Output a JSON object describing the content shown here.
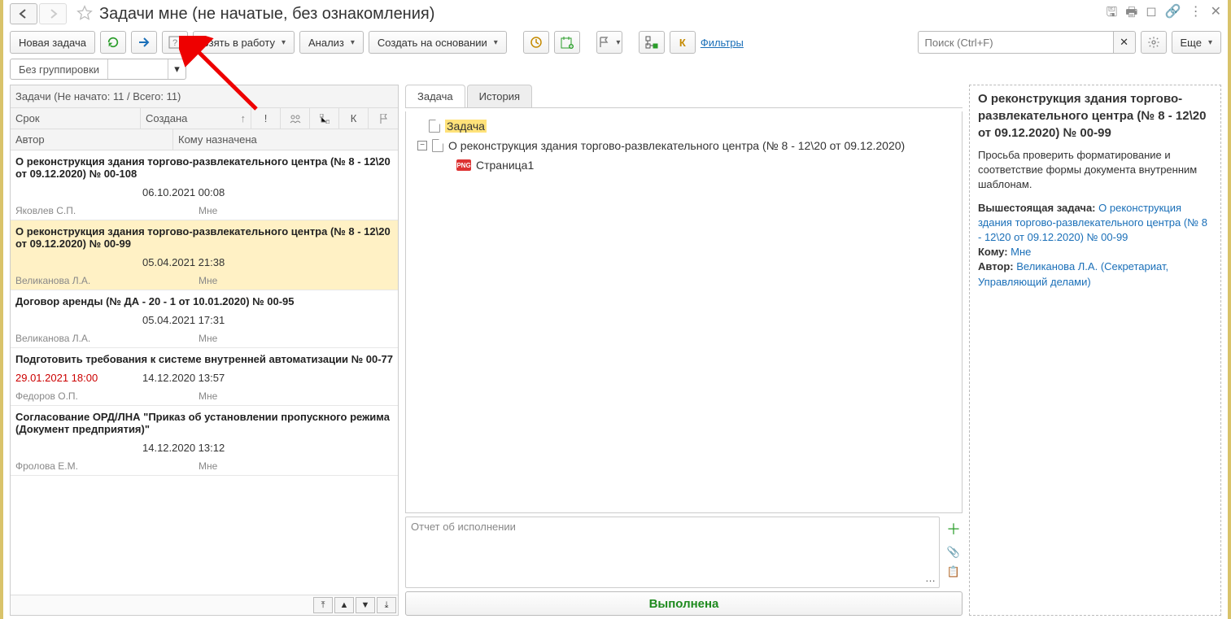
{
  "header": {
    "title": "Задачи мне (не начатые, без ознакомления)"
  },
  "toolbar": {
    "new_task": "Новая задача",
    "take_work": "Взять в работу",
    "analyze": "Анализ",
    "create_based": "Создать на основании",
    "filters": "Фильтры",
    "search_placeholder": "Поиск (Ctrl+F)",
    "more": "Еще"
  },
  "grouping": {
    "value": "Без группировки"
  },
  "list_header": {
    "summary": "Задачи (Не начато: 11 / Всего: 11)",
    "col_due": "Срок",
    "col_created": "Создана",
    "col_author": "Автор",
    "col_assigned": "Кому назначена",
    "k": "К"
  },
  "tasks": [
    {
      "title": "О реконструкция здания торгово-развлекательного центра (№ 8 - 12\\20 от 09.12.2020) № 00-108",
      "due": "",
      "created": "06.10.2021 00:08",
      "author": "Яковлев С.П.",
      "assigned": "Мне",
      "selected": false,
      "due_red": false
    },
    {
      "title": "О реконструкция здания торгово-развлекательного центра (№ 8 - 12\\20 от 09.12.2020) № 00-99",
      "due": "",
      "created": "05.04.2021 21:38",
      "author": "Великанова Л.А.",
      "assigned": "Мне",
      "selected": true,
      "due_red": false
    },
    {
      "title": "Договор аренды (№ ДА - 20 - 1 от 10.01.2020) № 00-95",
      "due": "",
      "created": "05.04.2021 17:31",
      "author": "Великанова Л.А.",
      "assigned": "Мне",
      "selected": false,
      "due_red": false
    },
    {
      "title": "Подготовить требования к системе внутренней автоматизации № 00-77",
      "due": "29.01.2021 18:00",
      "created": "14.12.2020 13:57",
      "author": "Федоров О.П.",
      "assigned": "Мне",
      "selected": false,
      "due_red": true
    },
    {
      "title": "Согласование ОРД/ЛНА \"Приказ об установлении пропускного режима (Документ предприятия)\"",
      "due": "",
      "created": "14.12.2020 13:12",
      "author": "Фролова Е.М.",
      "assigned": "Мне",
      "selected": false,
      "due_red": false
    }
  ],
  "mid": {
    "tab_task": "Задача",
    "tab_history": "История",
    "node_task": "Задача",
    "node_doc": "О реконструкция здания торгово-развлекательного центра (№ 8 - 12\\20 от 09.12.2020)",
    "node_page": "Страница1",
    "report_placeholder": "Отчет об исполнении",
    "done": "Выполнена",
    "png_label": "PNG"
  },
  "right": {
    "title": "О реконструкция здания торгово-развлекательного центра (№ 8 - 12\\20 от 09.12.2020) № 00-99",
    "desc": "Просьба проверить форматирование и соответствие формы документа внутренним шаблонам.",
    "parent_label": "Вышестоящая задача:",
    "parent_link": "О реконструкция здания торгово-развлекательного центра (№ 8 - 12\\20 от 09.12.2020) № 00-99",
    "to_label": "Кому:",
    "to_link": "Мне",
    "author_label": "Автор:",
    "author_link": "Великанова Л.А. (Секретариат, Управляющий делами)"
  }
}
